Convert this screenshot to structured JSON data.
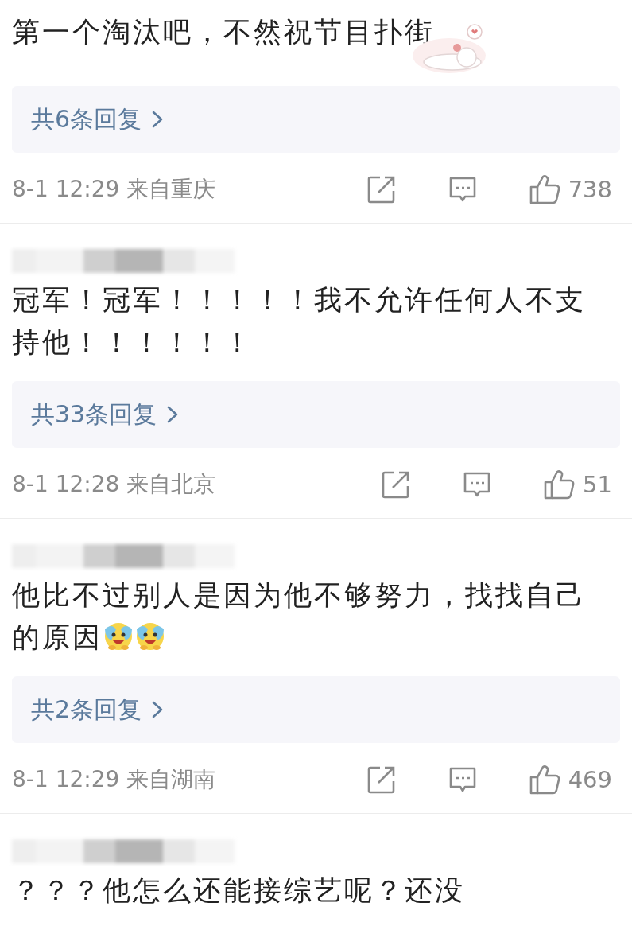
{
  "comments": [
    {
      "author_blurred": false,
      "text": "第一个淘汰吧，不然祝节目扑街",
      "stickers": [
        {
          "kind": "cat"
        }
      ],
      "replies": "共6条回复",
      "time": "8-1 12:29 来自重庆",
      "likes": "738"
    },
    {
      "author_blurred": true,
      "text": "冠军！冠军！！！！！我不允许任何人不支持他！！！！！！",
      "replies": "共33条回复",
      "time": "8-1 12:28 来自北京",
      "likes": "51"
    },
    {
      "author_blurred": true,
      "text": "他比不过别人是因为他不够努力，找找自己的原因",
      "stickers": [
        {
          "kind": "laugh-cry"
        },
        {
          "kind": "laugh-cry"
        }
      ],
      "replies": "共2条回复",
      "time": "8-1 12:29 来自湖南",
      "likes": "469"
    },
    {
      "author_blurred": true,
      "text": "？？？他怎么还能接综艺呢？还没"
    }
  ]
}
